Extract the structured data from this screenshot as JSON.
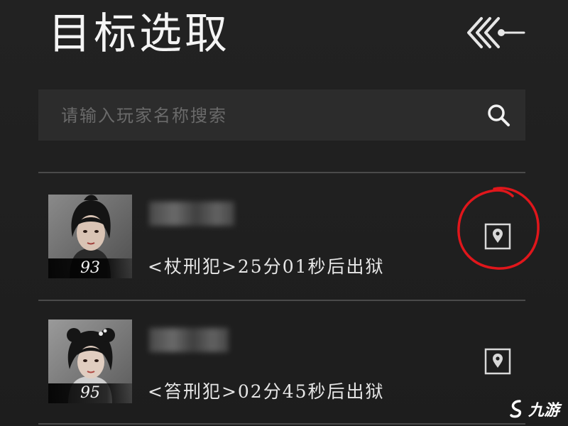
{
  "header": {
    "title": "目标选取",
    "back_icon": "triple-chevron-back-icon"
  },
  "search": {
    "placeholder": "请输入玩家名称搜索",
    "value": "",
    "icon": "search-icon"
  },
  "players": [
    {
      "level": "93",
      "status": "<杖刑犯>25分01秒后出狱",
      "locate_icon": "map-pin-icon"
    },
    {
      "level": "95",
      "status": "<笞刑犯>02分45秒后出狱",
      "locate_icon": "map-pin-icon"
    }
  ],
  "annotation": {
    "color": "#e0161b"
  },
  "watermark": {
    "text": "九游"
  },
  "colors": {
    "background": "#1f1f1f",
    "search_bg": "#2c2c2c",
    "divider": "#4a4a4a",
    "text": "#e6e6e6"
  }
}
